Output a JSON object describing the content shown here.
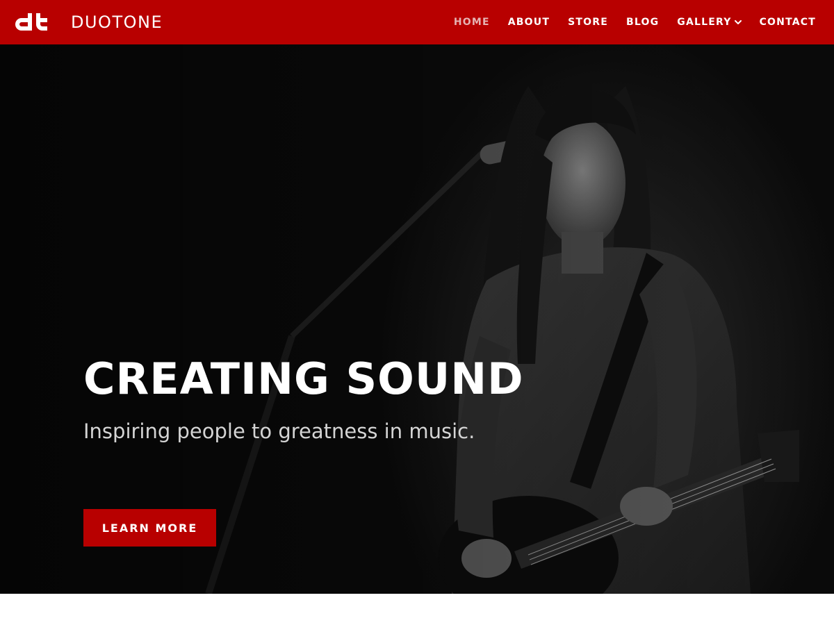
{
  "header": {
    "site_name": "DUOTONE",
    "logo_icon": "dt-monogram-logo",
    "background_color": "#b80000",
    "active_color": "#e6b3b3"
  },
  "nav": {
    "items": [
      {
        "label": "HOME",
        "active": true
      },
      {
        "label": "ABOUT",
        "active": false
      },
      {
        "label": "STORE",
        "active": false
      },
      {
        "label": "BLOG",
        "active": false
      },
      {
        "label": "GALLERY",
        "active": false,
        "has_dropdown": true,
        "icon": "chevron-down-icon"
      },
      {
        "label": "CONTACT",
        "active": false
      }
    ]
  },
  "hero": {
    "title": "CREATING SOUND",
    "subtitle": "Inspiring people to greatness in music.",
    "cta_label": "LEARN MORE",
    "cta_color": "#b80000",
    "image": "black-and-white photo of a dreadlocked guitarist playing an electric guitar at a microphone on a dark stage"
  }
}
